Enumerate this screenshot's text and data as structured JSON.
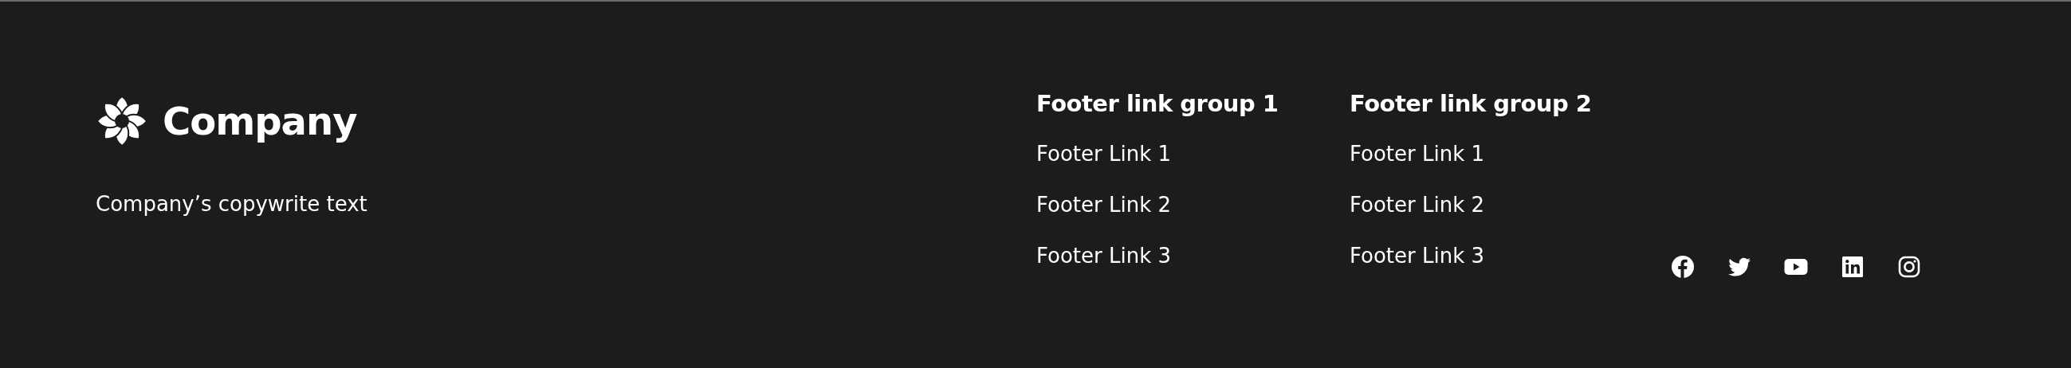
{
  "brand": {
    "name": "Company",
    "copyright": "Company’s copywrite text"
  },
  "link_groups": [
    {
      "title": "Footer link group 1",
      "links": [
        "Footer Link 1",
        "Footer Link 2",
        "Footer Link 3"
      ]
    },
    {
      "title": "Footer link group 2",
      "links": [
        "Footer Link 1",
        "Footer Link 2",
        "Footer Link 3"
      ]
    }
  ],
  "social_links": [
    {
      "kind": "facebook"
    },
    {
      "kind": "twitter"
    },
    {
      "kind": "youtube"
    },
    {
      "kind": "linkedin"
    },
    {
      "kind": "instagram"
    }
  ]
}
